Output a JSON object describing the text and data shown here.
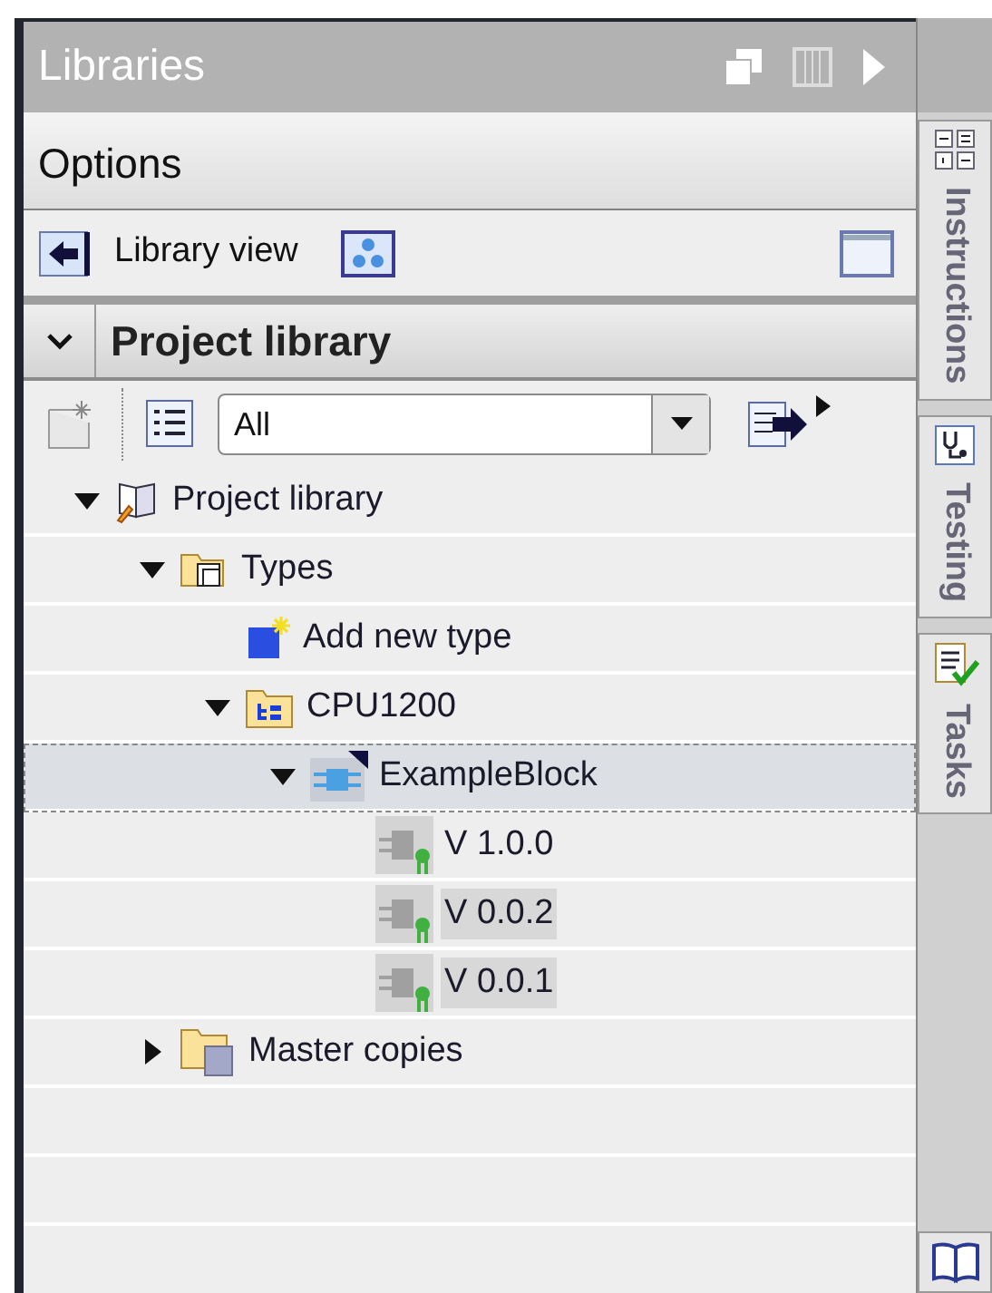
{
  "panel": {
    "title": "Libraries"
  },
  "options": {
    "title": "Options",
    "library_view": "Library view"
  },
  "project_library": {
    "title": "Project library",
    "expanded": true,
    "filter": {
      "value": "All"
    }
  },
  "tree": [
    {
      "label": "Project library",
      "kind": "library",
      "expanded": true,
      "focused": false,
      "selected": false,
      "children": [
        {
          "label": "Types",
          "kind": "types",
          "expanded": true,
          "focused": false,
          "selected": false,
          "children": [
            {
              "label": "Add new type",
              "kind": "add",
              "focused": false,
              "selected": false
            },
            {
              "label": "CPU1200",
              "kind": "group",
              "expanded": true,
              "focused": false,
              "selected": false,
              "children": [
                {
                  "label": "ExampleBlock",
                  "kind": "block",
                  "expanded": true,
                  "focused": true,
                  "selected": false,
                  "children": [
                    {
                      "label": "V 1.0.0",
                      "kind": "version",
                      "focused": false,
                      "selected": false
                    },
                    {
                      "label": "V 0.0.2",
                      "kind": "version",
                      "focused": false,
                      "selected": true
                    },
                    {
                      "label": "V 0.0.1",
                      "kind": "version",
                      "focused": false,
                      "selected": true
                    }
                  ]
                }
              ]
            }
          ]
        },
        {
          "label": "Master copies",
          "kind": "folder",
          "expanded": false,
          "focused": false,
          "selected": false
        }
      ]
    }
  ],
  "side_tabs": [
    {
      "label": "Instructions",
      "kind": "grid"
    },
    {
      "label": "Testing",
      "kind": "probe"
    },
    {
      "label": "Tasks",
      "kind": "tasks"
    }
  ]
}
